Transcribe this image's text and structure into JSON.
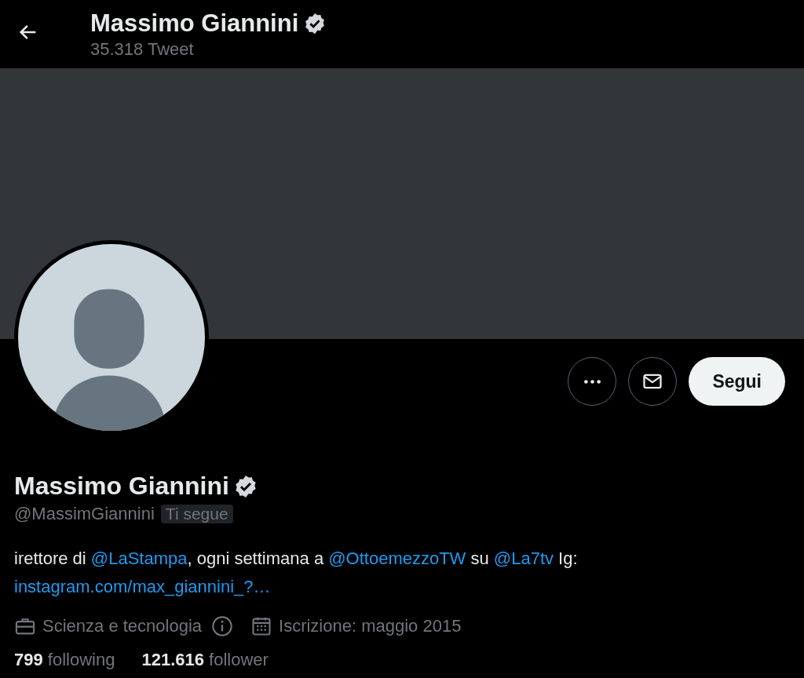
{
  "header": {
    "name": "Massimo Giannini",
    "verified": true,
    "tweet_count": "35.318 Tweet"
  },
  "profile": {
    "name": "Massimo Giannini",
    "verified": true,
    "handle": "@MassimGiannini",
    "follows_you_badge": "Ti segue"
  },
  "actions": [
    {
      "kind": "more"
    },
    {
      "kind": "message"
    },
    {
      "kind": "follow",
      "label": "Segui"
    }
  ],
  "bio": [
    {
      "kind": "text",
      "text": "irettore di "
    },
    {
      "kind": "link",
      "text": "@LaStampa"
    },
    {
      "kind": "text",
      "text": ", ogni settimana a "
    },
    {
      "kind": "link",
      "text": "@OttoemezzoTW"
    },
    {
      "kind": "text",
      "text": " su "
    },
    {
      "kind": "link",
      "text": "@La7tv"
    },
    {
      "kind": "text",
      "text": " Ig: "
    },
    {
      "kind": "link",
      "text": "instagram.com/max_giannini_?…"
    }
  ],
  "meta": [
    {
      "kind": "category",
      "text": "Scienza e tecnologia"
    },
    {
      "kind": "joined",
      "text": "Iscrizione: maggio 2015"
    }
  ],
  "stats": [
    {
      "count": "799",
      "label": "following"
    },
    {
      "count": "121.616",
      "label": "follower"
    }
  ]
}
